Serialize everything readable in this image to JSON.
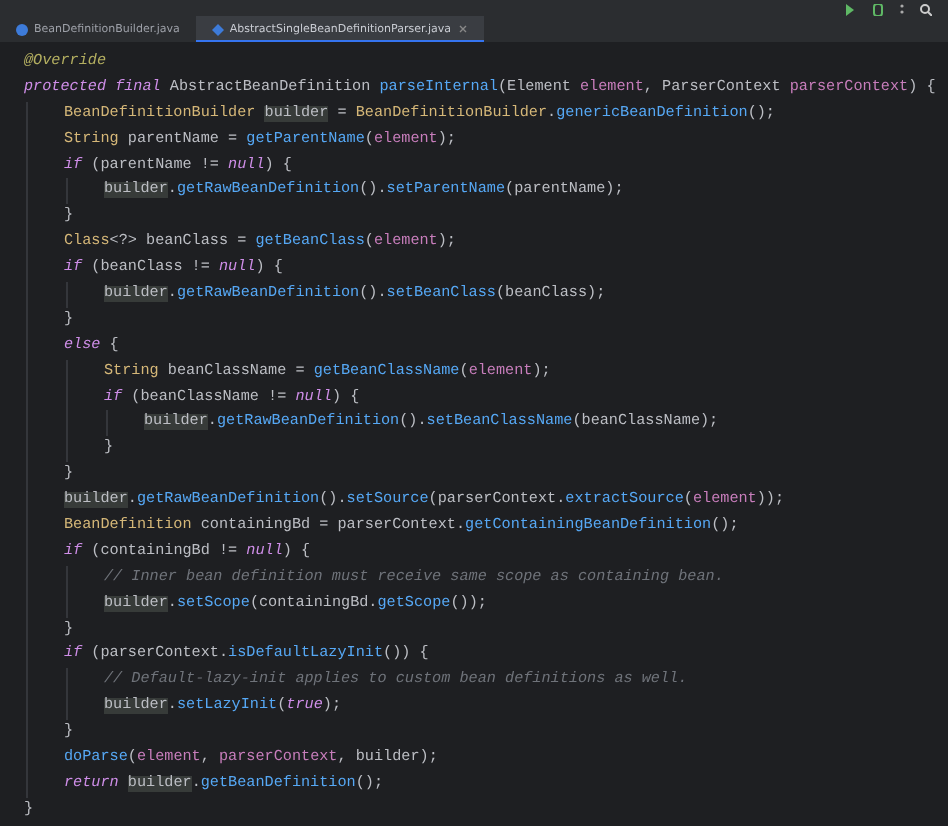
{
  "tabs": [
    {
      "label": "BeanDefinitionBuilder.java",
      "selected": false
    },
    {
      "label": "AbstractSingleBeanDefinitionParser.java",
      "selected": true
    }
  ],
  "code": [
    {
      "tokens": [
        {
          "text": "@Override",
          "kind": "annotation"
        }
      ]
    },
    {
      "tokens": [
        {
          "text": "protected final",
          "kind": "keyword"
        },
        {
          "text": " AbstractBeanDefinition ",
          "kind": "plain"
        },
        {
          "text": "parseInternal",
          "kind": "method"
        },
        {
          "text": "(Element ",
          "kind": "plain"
        },
        {
          "text": "element",
          "kind": "param"
        },
        {
          "text": ", ParserContext ",
          "kind": "plain"
        },
        {
          "text": "parserContext",
          "kind": "param"
        },
        {
          "text": ") {",
          "kind": "plain"
        }
      ],
      "children": [
        {
          "tokens": [
            {
              "text": "BeanDefinitionBuilder ",
              "kind": "type"
            },
            {
              "text": "builder",
              "kind": "highlight"
            },
            {
              "text": " = ",
              "kind": "plain"
            },
            {
              "text": "BeanDefinitionBuilder",
              "kind": "type"
            },
            {
              "text": ".",
              "kind": "plain"
            },
            {
              "text": "genericBeanDefinition",
              "kind": "method"
            },
            {
              "text": "();",
              "kind": "plain"
            }
          ]
        },
        {
          "tokens": [
            {
              "text": "String",
              "kind": "type"
            },
            {
              "text": " parentName = ",
              "kind": "plain"
            },
            {
              "text": "getParentName",
              "kind": "method"
            },
            {
              "text": "(",
              "kind": "plain"
            },
            {
              "text": "element",
              "kind": "param"
            },
            {
              "text": ");",
              "kind": "plain"
            }
          ]
        },
        {
          "tokens": [
            {
              "text": "if",
              "kind": "keyword"
            },
            {
              "text": " (parentName != ",
              "kind": "plain"
            },
            {
              "text": "null",
              "kind": "keyword"
            },
            {
              "text": ") {",
              "kind": "plain"
            }
          ],
          "children": [
            {
              "tokens": [
                {
                  "text": "builder",
                  "kind": "highlight"
                },
                {
                  "text": ".",
                  "kind": "plain"
                },
                {
                  "text": "getRawBeanDefinition",
                  "kind": "method"
                },
                {
                  "text": "().",
                  "kind": "plain"
                },
                {
                  "text": "setParentName",
                  "kind": "method"
                },
                {
                  "text": "(parentName);",
                  "kind": "plain"
                }
              ]
            }
          ]
        },
        {
          "tokens": [
            {
              "text": "}",
              "kind": "plain"
            }
          ]
        },
        {
          "tokens": [
            {
              "text": "Class",
              "kind": "type"
            },
            {
              "text": "<?> beanClass = ",
              "kind": "plain"
            },
            {
              "text": "getBeanClass",
              "kind": "method"
            },
            {
              "text": "(",
              "kind": "plain"
            },
            {
              "text": "element",
              "kind": "param"
            },
            {
              "text": ");",
              "kind": "plain"
            }
          ]
        },
        {
          "tokens": [
            {
              "text": "if",
              "kind": "keyword"
            },
            {
              "text": " (beanClass != ",
              "kind": "plain"
            },
            {
              "text": "null",
              "kind": "keyword"
            },
            {
              "text": ") {",
              "kind": "plain"
            }
          ],
          "children": [
            {
              "tokens": [
                {
                  "text": "builder",
                  "kind": "highlight"
                },
                {
                  "text": ".",
                  "kind": "plain"
                },
                {
                  "text": "getRawBeanDefinition",
                  "kind": "method"
                },
                {
                  "text": "().",
                  "kind": "plain"
                },
                {
                  "text": "setBeanClass",
                  "kind": "method"
                },
                {
                  "text": "(beanClass);",
                  "kind": "plain"
                }
              ]
            }
          ]
        },
        {
          "tokens": [
            {
              "text": "}",
              "kind": "plain"
            }
          ]
        },
        {
          "tokens": [
            {
              "text": "else",
              "kind": "keyword"
            },
            {
              "text": " {",
              "kind": "plain"
            }
          ],
          "children": [
            {
              "tokens": [
                {
                  "text": "String",
                  "kind": "type"
                },
                {
                  "text": " beanClassName = ",
                  "kind": "plain"
                },
                {
                  "text": "getBeanClassName",
                  "kind": "method"
                },
                {
                  "text": "(",
                  "kind": "plain"
                },
                {
                  "text": "element",
                  "kind": "param"
                },
                {
                  "text": ");",
                  "kind": "plain"
                }
              ]
            },
            {
              "tokens": [
                {
                  "text": "if",
                  "kind": "keyword"
                },
                {
                  "text": " (beanClassName != ",
                  "kind": "plain"
                },
                {
                  "text": "null",
                  "kind": "keyword"
                },
                {
                  "text": ") {",
                  "kind": "plain"
                }
              ],
              "children": [
                {
                  "tokens": [
                    {
                      "text": "builder",
                      "kind": "highlight"
                    },
                    {
                      "text": ".",
                      "kind": "plain"
                    },
                    {
                      "text": "getRawBeanDefinition",
                      "kind": "method"
                    },
                    {
                      "text": "().",
                      "kind": "plain"
                    },
                    {
                      "text": "setBeanClassName",
                      "kind": "method"
                    },
                    {
                      "text": "(beanClassName);",
                      "kind": "plain"
                    }
                  ]
                }
              ]
            },
            {
              "tokens": [
                {
                  "text": "}",
                  "kind": "plain"
                }
              ]
            }
          ]
        },
        {
          "tokens": [
            {
              "text": "}",
              "kind": "plain"
            }
          ]
        },
        {
          "tokens": [
            {
              "text": "builder",
              "kind": "highlight"
            },
            {
              "text": ".",
              "kind": "plain"
            },
            {
              "text": "getRawBeanDefinition",
              "kind": "method"
            },
            {
              "text": "().",
              "kind": "plain"
            },
            {
              "text": "setSource",
              "kind": "method"
            },
            {
              "text": "(parserContext.",
              "kind": "plain"
            },
            {
              "text": "extractSource",
              "kind": "method"
            },
            {
              "text": "(",
              "kind": "plain"
            },
            {
              "text": "element",
              "kind": "param"
            },
            {
              "text": "));",
              "kind": "plain"
            }
          ]
        },
        {
          "tokens": [
            {
              "text": "BeanDefinition",
              "kind": "type"
            },
            {
              "text": " containingBd = parserContext.",
              "kind": "plain"
            },
            {
              "text": "getContainingBeanDefinition",
              "kind": "method"
            },
            {
              "text": "();",
              "kind": "plain"
            }
          ]
        },
        {
          "tokens": [
            {
              "text": "if",
              "kind": "keyword"
            },
            {
              "text": " (containingBd != ",
              "kind": "plain"
            },
            {
              "text": "null",
              "kind": "keyword"
            },
            {
              "text": ") {",
              "kind": "plain"
            }
          ],
          "children": [
            {
              "tokens": [
                {
                  "text": "// Inner bean definition must receive same scope as containing bean.",
                  "kind": "comment"
                }
              ]
            },
            {
              "tokens": [
                {
                  "text": "builder",
                  "kind": "highlight"
                },
                {
                  "text": ".",
                  "kind": "plain"
                },
                {
                  "text": "setScope",
                  "kind": "method"
                },
                {
                  "text": "(containingBd.",
                  "kind": "plain"
                },
                {
                  "text": "getScope",
                  "kind": "method"
                },
                {
                  "text": "());",
                  "kind": "plain"
                }
              ]
            }
          ]
        },
        {
          "tokens": [
            {
              "text": "}",
              "kind": "plain"
            }
          ]
        },
        {
          "tokens": [
            {
              "text": "if",
              "kind": "keyword"
            },
            {
              "text": " (parserContext.",
              "kind": "plain"
            },
            {
              "text": "isDefaultLazyInit",
              "kind": "method"
            },
            {
              "text": "()) {",
              "kind": "plain"
            }
          ],
          "children": [
            {
              "tokens": [
                {
                  "text": "// Default-lazy-init applies to custom bean definitions as well.",
                  "kind": "comment"
                }
              ]
            },
            {
              "tokens": [
                {
                  "text": "builder",
                  "kind": "highlight"
                },
                {
                  "text": ".",
                  "kind": "plain"
                },
                {
                  "text": "setLazyInit",
                  "kind": "method"
                },
                {
                  "text": "(",
                  "kind": "plain"
                },
                {
                  "text": "true",
                  "kind": "keyword"
                },
                {
                  "text": ");",
                  "kind": "plain"
                }
              ]
            }
          ]
        },
        {
          "tokens": [
            {
              "text": "}",
              "kind": "plain"
            }
          ]
        },
        {
          "tokens": [
            {
              "text": "doParse",
              "kind": "method"
            },
            {
              "text": "(",
              "kind": "plain"
            },
            {
              "text": "element",
              "kind": "param"
            },
            {
              "text": ", ",
              "kind": "plain"
            },
            {
              "text": "parserContext",
              "kind": "param"
            },
            {
              "text": ", ",
              "kind": "plain"
            },
            {
              "text": "builder",
              "kind": "plain"
            },
            {
              "text": ");",
              "kind": "plain"
            }
          ]
        },
        {
          "tokens": [
            {
              "text": "return ",
              "kind": "keyword"
            },
            {
              "text": "builder",
              "kind": "highlight"
            },
            {
              "text": ".",
              "kind": "plain"
            },
            {
              "text": "getBeanDefinition",
              "kind": "method"
            },
            {
              "text": "();",
              "kind": "plain"
            }
          ]
        }
      ]
    },
    {
      "tokens": [
        {
          "text": "}",
          "kind": "plain"
        }
      ]
    }
  ]
}
